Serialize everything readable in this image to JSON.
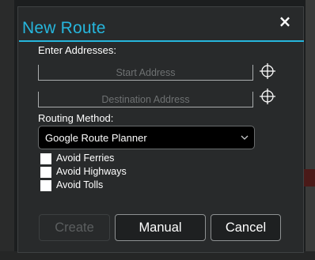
{
  "dialog": {
    "title": "New Route",
    "close_label": "×"
  },
  "addresses": {
    "section_label": "Enter Addresses:",
    "start_placeholder": "Start Address",
    "destination_placeholder": "Destination Address"
  },
  "routing": {
    "label": "Routing Method:",
    "selected": "Google Route Planner"
  },
  "options": [
    {
      "label": "Avoid Ferries",
      "checked": false
    },
    {
      "label": "Avoid Highways",
      "checked": false
    },
    {
      "label": "Avoid Tolls",
      "checked": false
    }
  ],
  "buttons": {
    "create": "Create",
    "manual": "Manual",
    "cancel": "Cancel"
  },
  "icons": {
    "close": "close-icon",
    "crosshair": "crosshair-icon",
    "dropdown": "chevron-down-icon"
  },
  "colors": {
    "accent": "#26b6dd",
    "dialog_bg": "#282a2b",
    "checkbox": "#ffffff"
  }
}
